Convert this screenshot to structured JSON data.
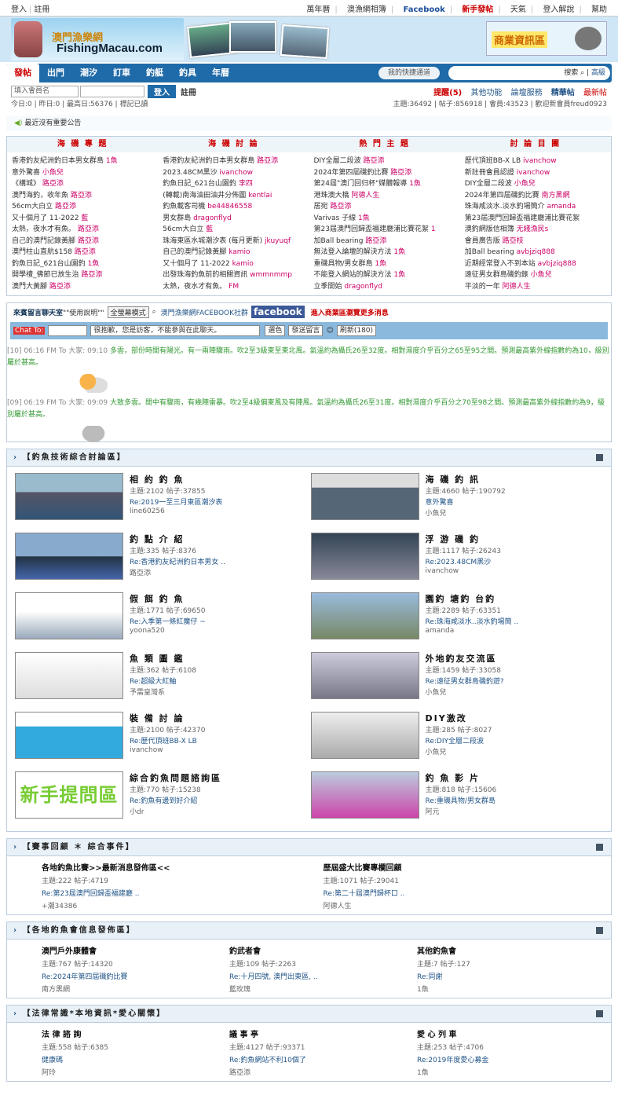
{
  "topbar": {
    "login": "登入",
    "register": "註冊",
    "links": [
      "萬年曆",
      "澳漁網相簿",
      "Facebook",
      "新手發帖",
      "天氣",
      "登入解說",
      "幫助"
    ]
  },
  "brand": {
    "cn": "澳門漁樂網",
    "en": "FishingMacau.com",
    "biz": "商業資訊區"
  },
  "nav": {
    "items": [
      "發帖",
      "出門",
      "潮汐",
      "訂車",
      "釣艇",
      "釣具",
      "年曆"
    ],
    "quick": "我的快捷通道",
    "search": "搜索",
    "advanced": "高級"
  },
  "login": {
    "placeholder": "填入會員名",
    "submit": "登入",
    "register": "註冊",
    "links": [
      "提醒(5)",
      "其他功能",
      "論壇服務",
      "精華帖",
      "最新帖"
    ]
  },
  "stats": {
    "left": "今日:0 | 昨日:0 | 最高日:56376 | 標記已讀",
    "right": "主題:36492 | 帖子:856918 | 會員:43523 | 歡迎新會員freud0923"
  },
  "announce": "最近沒有重要公告",
  "grid": {
    "cols": [
      {
        "title": "海 磯 專 題",
        "items": [
          [
            "香港釣友紀洲釣日本男女群島",
            "1魚"
          ],
          [
            "意外驚喜",
            "小魚兒"
          ],
          [
            "《構城》",
            "路亞添"
          ],
          [
            "澳門海釣，收年魚",
            "路亞添"
          ],
          [
            "56cm大白立",
            "路亞添"
          ],
          [
            "又十個月了 11-2022",
            "藍"
          ],
          [
            "太熱，夜水才有魚。",
            "路亞添"
          ],
          [
            "自己的澳門記錄黃腳",
            "路亞添"
          ],
          [
            "澳門柱山直航$158",
            "路亞添"
          ],
          [
            "釣魚日記_621台山園釣",
            "1魚"
          ],
          [
            "開學禮_佛節已放生治",
            "路亞添"
          ],
          [
            "澳門大黃腳",
            "路亞添"
          ]
        ]
      },
      {
        "title": "海 磯 討 論",
        "items": [
          [
            "香港釣友紀洲釣日本男女群島",
            "路亞添"
          ],
          [
            "2023.48CM黑沙",
            "ivanchow"
          ],
          [
            "釣魚日記_621台山園釣",
            "李四"
          ],
          [
            "(轉載)南海油田油井分佈圖",
            "kentlai"
          ],
          [
            "釣魚載客司機",
            "be44846558"
          ],
          [
            "男女群島",
            "dragonflyd"
          ],
          [
            "56cm大白立",
            "藍"
          ],
          [
            "珠海東區水城潮汐表 (每月更新)",
            "jkuyuqf"
          ],
          [
            "自己的澳門記錄黃腳",
            "kamio"
          ],
          [
            "又十個月了 11-2022",
            "kamio"
          ],
          [
            "出發珠海釣魚前的相關資訊",
            "wmmnmmp"
          ],
          [
            "太熱，夜水才有魚。",
            "FM"
          ]
        ]
      },
      {
        "title": "熱 門 主 題",
        "items": [
          [
            "DIY全層二段波",
            "路亞添"
          ],
          [
            "2024年第四屆磯釣比賽",
            "路亞添"
          ],
          [
            "第24屆\"澳门回归杯\"媒體報導",
            "1魚"
          ],
          [
            "港珠澳大橋",
            "阿德人生"
          ],
          [
            "居宛",
            "路亞添"
          ],
          [
            "Varivas 子線",
            "1魚"
          ],
          [
            "第23屆澳門回歸盃福建廳浦比賽花絮",
            "1"
          ],
          [
            "加Ball bearing",
            "路亞添"
          ],
          [
            "無法登入論壇的解決方法",
            "1魚"
          ],
          [
            "重磯具物/男女群島",
            "1魚"
          ],
          [
            "不能登入網站的解決方法",
            "1魚"
          ],
          [
            "立季開始",
            "dragonflyd"
          ]
        ]
      },
      {
        "title": "討 論 目 團",
        "items": [
          [
            "歷代頂班BB-X LB",
            "ivanchow"
          ],
          [
            "新註冊會員認證",
            "ivanchow"
          ],
          [
            "DIY全層二段波",
            "小魚兒"
          ],
          [
            "2024年第四屆磯釣比賽",
            "南方黑網"
          ],
          [
            "珠海咸淡水.淡水釣場簡介",
            "amanda"
          ],
          [
            "第23屆澳門回歸盃福建廳浦比賽花絮",
            ""
          ],
          [
            "澳釣網版信相簿",
            "无綫漁民s"
          ],
          [
            "會員廣告版",
            "路亞枝"
          ],
          [
            "加Ball bearing",
            "avbjziq888"
          ],
          [
            "近期經常登入不到本站",
            "avbjziq888"
          ],
          [
            "遠征男女群島磯釣錄",
            "小魚兒"
          ],
          [
            "平淡的一年",
            "阿德人生"
          ]
        ]
      }
    ]
  },
  "chat": {
    "title": "來賓留言聊天室",
    "help": "\"\"使用說明\"\"",
    "fullscreen": "全螢幕模式",
    "fbtext": "澳門漁樂網FACEBOOK社群",
    "fb": "facebook",
    "biz": "進入商業區瀏覽更多消息",
    "chatto": "Chat To:",
    "notice": "很抱歉，您是訪客，不能參與在此聊天。",
    "color": "選色",
    "send": "發送留言",
    "refresh": "刷新(180)",
    "msgs": [
      {
        "head": "[10] 06:16 FM To 大家: 09:10",
        "body": "多雲，部份時間有陽光。有一兩陣驟雨。吹2至3級東至東北風。氣溫約為攝氏26至32度。相對濕度介乎百分之65至95之間。預測最高紫外線指數約為10，級別屬於甚高。"
      },
      {
        "head": "[09] 06:19 FM To 大家: 09:09",
        "body": "大致多雲。間中有驟雨，有幾陣雷暴。吹2至4級偏東風及有陣風。氣溫約為攝氏26至31度。相對濕度介乎百分之70至98之間。預測最高紫外線指數約為9，級別屬於甚高。"
      }
    ]
  },
  "sec1": {
    "title": "【釣魚技術綜合討論區】",
    "forums": [
      {
        "name": "相 約 釣 魚",
        "meta": "主題:2102  帖子:37855",
        "last": "Re:2019一至三月東區潮汐表",
        "user": "line60256"
      },
      {
        "name": "海 磯 釣 訊",
        "meta": "主題:4660  帖子:190792",
        "last": "意外驚喜",
        "user": "小魚兒"
      },
      {
        "name": "釣 點 介 紹",
        "meta": "主題:335  帖子:8376",
        "last": "Re:香港釣友紀洲釣日本男女 ..",
        "user": "路亞添"
      },
      {
        "name": "浮 游 磯 釣",
        "meta": "主題:1117  帖子:26243",
        "last": "Re:2023.48CM黑沙",
        "user": "ivanchow"
      },
      {
        "name": "假 餌 釣 魚",
        "meta": "主題:1771  帖子:69650",
        "last": "Re:入季第一條紅魔仔 ~",
        "user": "yoona520"
      },
      {
        "name": "園釣 塘釣 台釣",
        "meta": "主題:2289  帖子:63351",
        "last": "Re:珠海咸淡水..淡水釣場簡 ..",
        "user": "amanda"
      },
      {
        "name": "魚 類 圖 鑑",
        "meta": "主題:362  帖子:6108",
        "last": "Re:超級大紅鮋",
        "user": "予需皇灣系"
      },
      {
        "name": "外地釣友交流區",
        "meta": "主題:1459  帖子:33058",
        "last": "Re:遠征男女群島磯釣遊?",
        "user": "小魚兒"
      },
      {
        "name": "裝 備 討 論",
        "meta": "主題:2100  帖子:42370",
        "last": "Re:歷代頂班BB-X LB",
        "user": "ivanchow"
      },
      {
        "name": "DIY激改",
        "meta": "主題:285  帖子:8027",
        "last": "Re:DIY全層二段波",
        "user": "小魚兒"
      },
      {
        "name": "綜合釣魚問題諮詢區",
        "meta": "主題:770  帖子:15238",
        "last": "Re:釣魚有邊到好介紹",
        "user": "小dr"
      },
      {
        "name": "釣 魚 影 片",
        "meta": "主題:818  帖子:15606",
        "last": "Re:重磯具物/男女群島",
        "user": "阿元"
      }
    ]
  },
  "newbie_img": "新手提問區",
  "sec2": {
    "title": "【賽事回顧  ＊  綜合事件】",
    "forums": [
      {
        "name": "各地釣魚比賽>>最新消息發佈區<<",
        "meta": "主題:222  帖子:4719",
        "last": "Re:第23屆澳門回歸盃福建廳 ..",
        "user": "+潮34386"
      },
      {
        "name": "歷屆盛大比賽專欄回顧",
        "meta": "主題:1071  帖子:29041",
        "last": "Re:第二十屆澳門歸杯口 ..",
        "user": "阿德人生"
      }
    ]
  },
  "sec3": {
    "title": "【各地釣魚會信息發佈區】",
    "forums": [
      {
        "name": "澳門戶外康體會",
        "meta": "主題:767  帖子:14320",
        "last": "Re:2024年第四屆磯釣比賽",
        "user": "南方黑網"
      },
      {
        "name": "釣武者會",
        "meta": "主題:109  帖子:2263",
        "last": "Re:十月四號, 澳門出東區, ..",
        "user": "藍玫瑰"
      },
      {
        "name": "其他釣魚會",
        "meta": "主題:7  帖子:127",
        "last": "Re:同謝",
        "user": "1魚"
      }
    ]
  },
  "sec4": {
    "title": "【法律常識*本地資訊*愛心關懷】",
    "forums": [
      {
        "name": "法 律 諮 詢",
        "meta": "主題:558  帖子:6385",
        "last": "健康碼",
        "user": "阿玲"
      },
      {
        "name": "議 事 亭",
        "meta": "主題:4127  帖子:93371",
        "last": "Re:釣魚網站不利10個了",
        "user": "路亞添"
      },
      {
        "name": "愛 心 列 車",
        "meta": "主題:253  帖子:4706",
        "last": "Re:2019年度愛心募金",
        "user": "1魚"
      }
    ]
  }
}
